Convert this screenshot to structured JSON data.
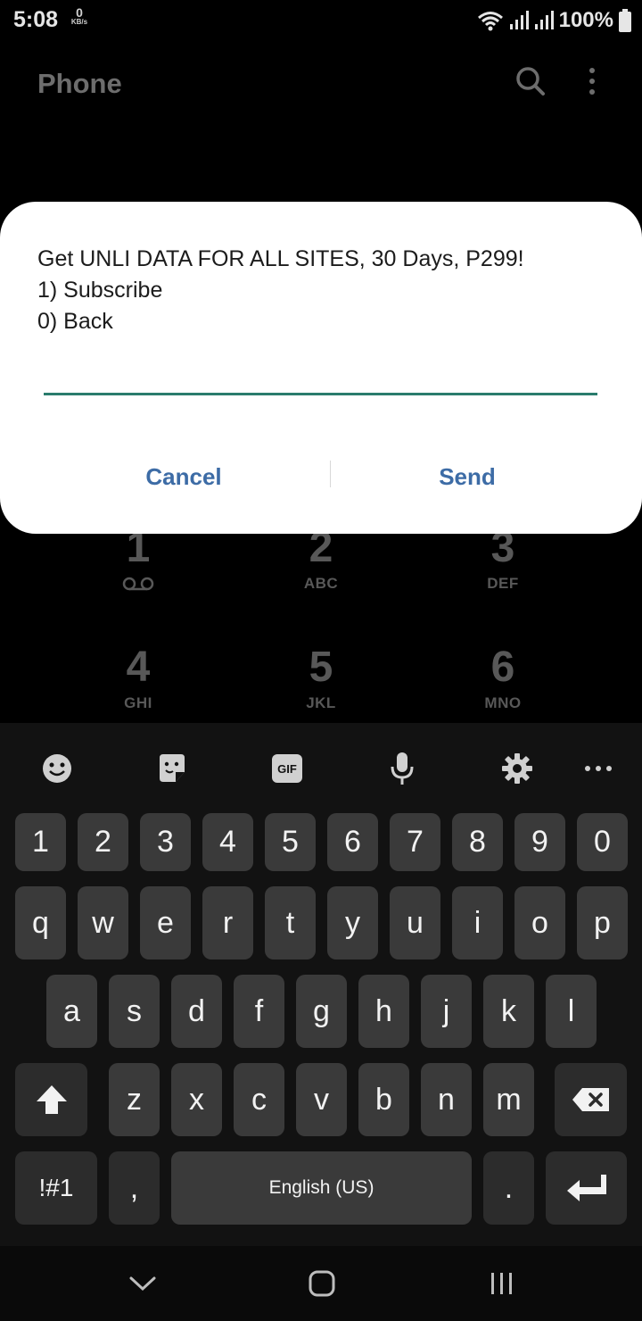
{
  "status": {
    "time": "5:08",
    "net_speed_value": "0",
    "net_speed_unit": "KB/s",
    "battery": "100%"
  },
  "app": {
    "title": "Phone",
    "search_icon": "search-icon",
    "more_icon": "more-vertical-icon"
  },
  "dialpad": [
    {
      "digit": "1",
      "letters": ""
    },
    {
      "digit": "2",
      "letters": "ABC"
    },
    {
      "digit": "3",
      "letters": "DEF"
    },
    {
      "digit": "4",
      "letters": "GHI"
    },
    {
      "digit": "5",
      "letters": "JKL"
    },
    {
      "digit": "6",
      "letters": "MNO"
    }
  ],
  "dialog": {
    "line1": "Get UNLI DATA FOR ALL SITES, 30 Days, P299!",
    "line2": "1) Subscribe",
    "line3": "0) Back",
    "input_value": "",
    "cancel_label": "Cancel",
    "send_label": "Send",
    "accent_color": "#2a7c6d",
    "button_color": "#3d6ca6"
  },
  "keyboard": {
    "toolbar": [
      "emoji-icon",
      "sticker-icon",
      "gif-icon",
      "microphone-icon",
      "settings-icon",
      "more-horizontal-icon"
    ],
    "gif_label": "GIF",
    "row_numbers": [
      "1",
      "2",
      "3",
      "4",
      "5",
      "6",
      "7",
      "8",
      "9",
      "0"
    ],
    "row_top": [
      "q",
      "w",
      "e",
      "r",
      "t",
      "y",
      "u",
      "i",
      "o",
      "p"
    ],
    "row_middle": [
      "a",
      "s",
      "d",
      "f",
      "g",
      "h",
      "j",
      "k",
      "l"
    ],
    "row_bottom": [
      "z",
      "x",
      "c",
      "v",
      "b",
      "n",
      "m"
    ],
    "symbols_label": "!#1",
    "comma_label": ",",
    "space_label": "English (US)",
    "period_label": "."
  },
  "navbar": [
    "back-chevron-icon",
    "home-icon",
    "recents-icon"
  ]
}
